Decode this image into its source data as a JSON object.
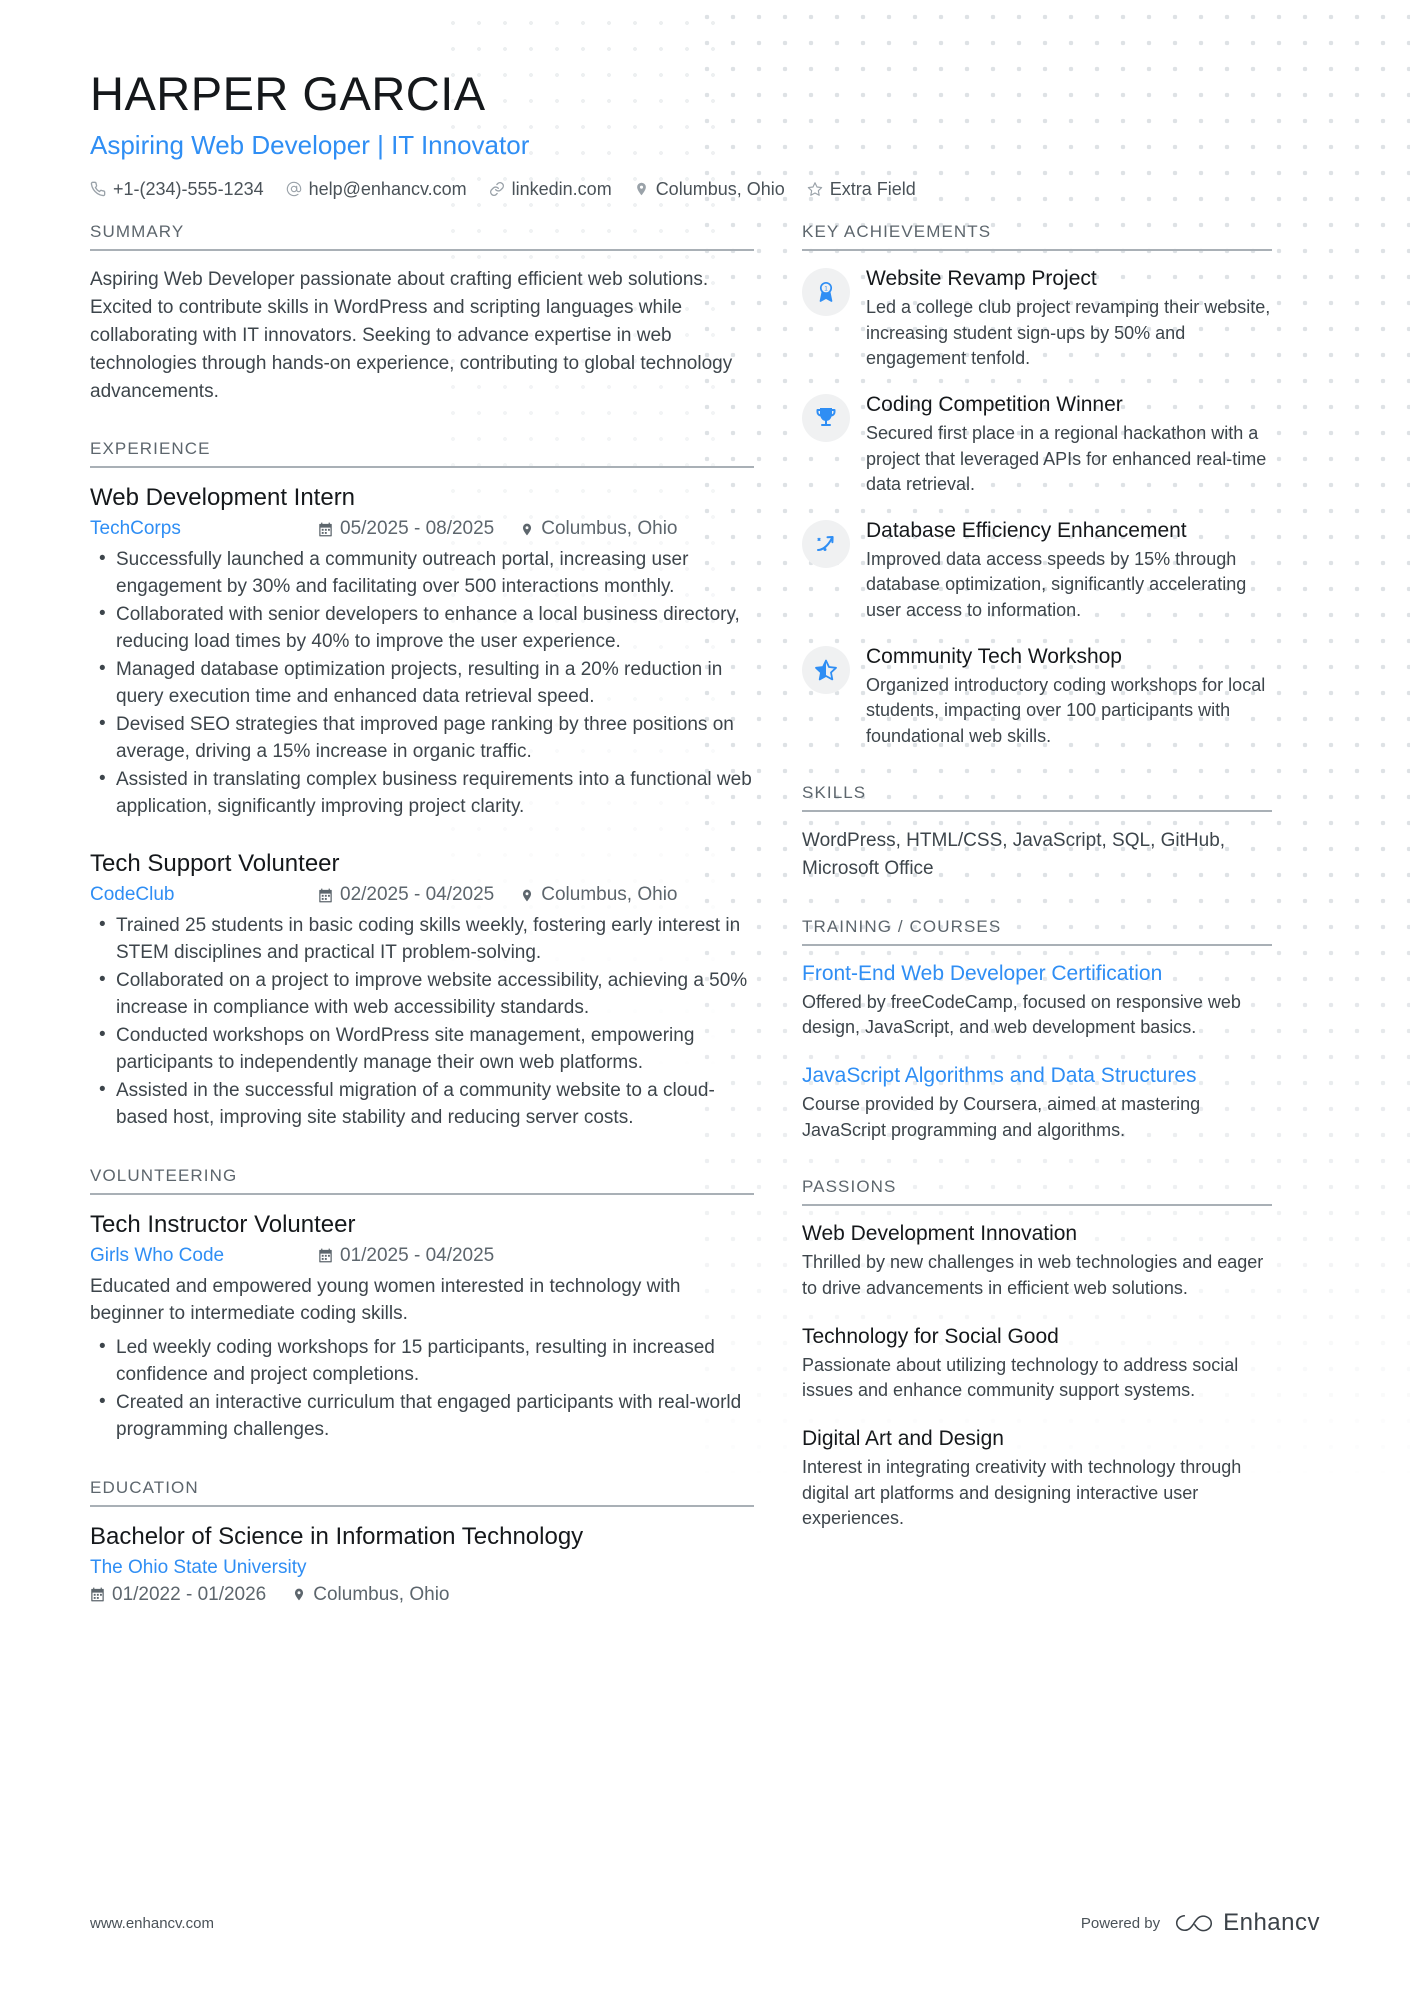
{
  "header": {
    "name": "HARPER GARCIA",
    "headline": "Aspiring Web Developer | IT Innovator",
    "contacts": [
      {
        "icon": "phone-icon",
        "text": "+1-(234)-555-1234"
      },
      {
        "icon": "email-icon",
        "text": "help@enhancv.com"
      },
      {
        "icon": "link-icon",
        "text": "linkedin.com"
      },
      {
        "icon": "location-pin-icon",
        "text": "Columbus, Ohio"
      },
      {
        "icon": "star-icon",
        "text": "Extra Field"
      }
    ]
  },
  "left": {
    "summary": {
      "title": "SUMMARY",
      "text": "Aspiring Web Developer passionate about crafting efficient web solutions. Excited to contribute skills in WordPress and scripting languages while collaborating with IT innovators. Seeking to advance expertise in web technologies through hands-on experience, contributing to global technology advancements."
    },
    "experience": {
      "title": "EXPERIENCE",
      "entries": [
        {
          "role": "Web Development Intern",
          "org": "TechCorps",
          "dates": "05/2025 - 08/2025",
          "location": "Columbus, Ohio",
          "bullets": [
            "Successfully launched a community outreach portal, increasing user engagement by 30% and facilitating over 500 interactions monthly.",
            "Collaborated with senior developers to enhance a local business directory, reducing load times by 40% to improve the user experience.",
            "Managed database optimization projects, resulting in a 20% reduction in query execution time and enhanced data retrieval speed.",
            "Devised SEO strategies that improved page ranking by three positions on average, driving a 15% increase in organic traffic.",
            "Assisted in translating complex business requirements into a functional web application, significantly improving project clarity."
          ]
        },
        {
          "role": "Tech Support Volunteer",
          "org": "CodeClub",
          "dates": "02/2025 - 04/2025",
          "location": "Columbus, Ohio",
          "bullets": [
            "Trained 25 students in basic coding skills weekly, fostering early interest in STEM disciplines and practical IT problem-solving.",
            "Collaborated on a project to improve website accessibility, achieving a 50% increase in compliance with web accessibility standards.",
            "Conducted workshops on WordPress site management, empowering participants to independently manage their own web platforms.",
            "Assisted in the successful migration of a community website to a cloud-based host, improving site stability and reducing server costs."
          ]
        }
      ]
    },
    "volunteering": {
      "title": "VOLUNTEERING",
      "entries": [
        {
          "role": "Tech Instructor Volunteer",
          "org": "Girls Who Code",
          "dates": "01/2025 - 04/2025",
          "description": "Educated and empowered young women interested in technology with beginner to intermediate coding skills.",
          "bullets": [
            "Led weekly coding workshops for 15 participants, resulting in increased confidence and project completions.",
            "Created an interactive curriculum that engaged participants with real-world programming challenges."
          ]
        }
      ]
    },
    "education": {
      "title": "EDUCATION",
      "entries": [
        {
          "degree": "Bachelor of Science in Information Technology",
          "school": "The Ohio State University",
          "dates": "01/2022 - 01/2026",
          "location": "Columbus, Ohio"
        }
      ]
    }
  },
  "right": {
    "achievements": {
      "title": "KEY ACHIEVEMENTS",
      "items": [
        {
          "icon": "award-ribbon-icon",
          "title": "Website Revamp Project",
          "text": "Led a college club project revamping their website, increasing student sign-ups by 50% and engagement tenfold."
        },
        {
          "icon": "trophy-icon",
          "title": "Coding Competition Winner",
          "text": "Secured first place in a regional hackathon with a project that leveraged APIs for enhanced real-time data retrieval."
        },
        {
          "icon": "trending-up-arrow-icon",
          "title": "Database Efficiency Enhancement",
          "text": "Improved data access speeds by 15% through database optimization, significantly accelerating user access to information."
        },
        {
          "icon": "half-star-icon",
          "title": "Community Tech Workshop",
          "text": "Organized introductory coding workshops for local students, impacting over 100 participants with foundational web skills."
        }
      ]
    },
    "skills": {
      "title": "SKILLS",
      "text": "WordPress, HTML/CSS, JavaScript, SQL, GitHub, Microsoft Office"
    },
    "training": {
      "title": "TRAINING / COURSES",
      "items": [
        {
          "name": "Front-End Web Developer Certification",
          "text": "Offered by freeCodeCamp, focused on responsive web design, JavaScript, and web development basics."
        },
        {
          "name": "JavaScript Algorithms and Data Structures",
          "text": "Course provided by Coursera, aimed at mastering JavaScript programming and algorithms."
        }
      ]
    },
    "passions": {
      "title": "PASSIONS",
      "items": [
        {
          "name": "Web Development Innovation",
          "text": "Thrilled by new challenges in web technologies and eager to drive advancements in efficient web solutions."
        },
        {
          "name": "Technology for Social Good",
          "text": "Passionate about utilizing technology to address social issues and enhance community support systems."
        },
        {
          "name": "Digital Art and Design",
          "text": "Interest in integrating creativity with technology through digital art platforms and designing interactive user experiences."
        }
      ]
    }
  },
  "footer": {
    "url": "www.enhancv.com",
    "powered_by": "Powered by",
    "brand": "Enhancv"
  },
  "colors": {
    "accent": "#2f8ef4",
    "heading": "#15181b",
    "body": "#3d454b",
    "muted": "#5d666d",
    "rule": "#a9b0b6",
    "icon_bg": "#f0f1f2"
  }
}
